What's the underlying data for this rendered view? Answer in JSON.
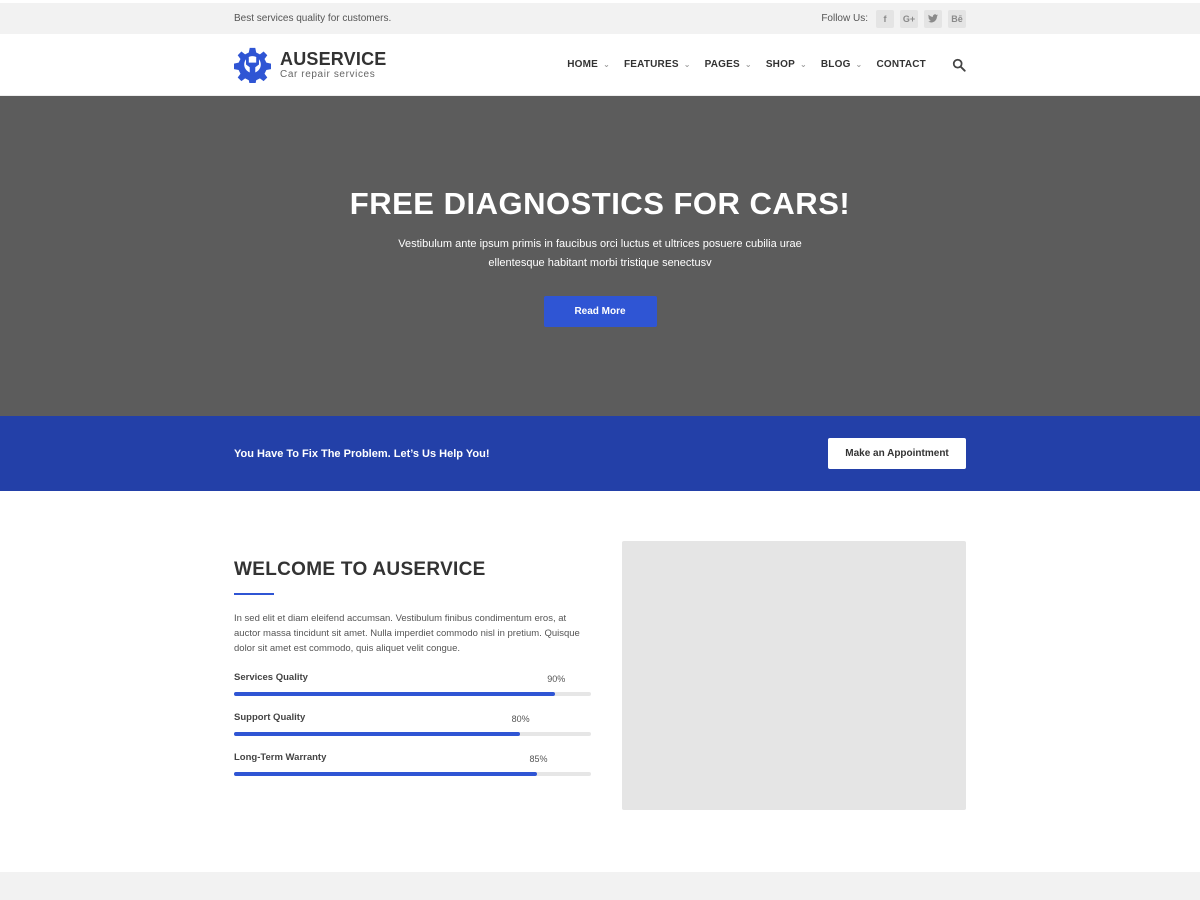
{
  "topbar": {
    "tagline": "Best services quality for customers.",
    "follow_label": "Follow Us:",
    "social": [
      {
        "icon": "facebook-icon",
        "glyph": "f"
      },
      {
        "icon": "google-plus-icon",
        "glyph": "G+"
      },
      {
        "icon": "twitter-icon",
        "glyph": "t"
      },
      {
        "icon": "behance-icon",
        "glyph": "Bē"
      }
    ]
  },
  "header": {
    "brand": "AUSERVICE",
    "brand_sub": "Car repair services",
    "logo_icon": "gear-wrench-icon",
    "nav": [
      {
        "label": "HOME",
        "has_dropdown": true
      },
      {
        "label": "FEATURES",
        "has_dropdown": true
      },
      {
        "label": "PAGES",
        "has_dropdown": true
      },
      {
        "label": "SHOP",
        "has_dropdown": true
      },
      {
        "label": "BLOG",
        "has_dropdown": true
      },
      {
        "label": "CONTACT",
        "has_dropdown": false
      }
    ],
    "search_icon": "search-icon"
  },
  "hero": {
    "title": "FREE DIAGNOSTICS FOR CARS!",
    "text": "Vestibulum ante ipsum primis in faucibus orci luctus et ultrices posuere cubilia urae ellentesque habitant morbi tristique senectusv",
    "button": "Read More",
    "bg_color": "#5c5c5c"
  },
  "cta": {
    "text": "You Have To Fix The Problem. Let’s Us Help You!",
    "button": "Make an Appointment",
    "bg_color": "#2340a8"
  },
  "welcome": {
    "title": "WELCOME TO AUSERVICE",
    "text": "In sed elit et diam eleifend accumsan. Vestibulum finibus condimentum eros, at auctor massa tincidunt sit amet. Nulla imperdiet commodo nisl in pretium. Quisque dolor sit amet est commodo, quis aliquet velit congue.",
    "skills": [
      {
        "name": "Services Quality",
        "percent": 90,
        "label": "90%"
      },
      {
        "name": "Support Quality",
        "percent": 80,
        "label": "80%"
      },
      {
        "name": "Long-Term Warranty",
        "percent": 85,
        "label": "85%"
      }
    ]
  },
  "colors": {
    "accent": "#2f55d4",
    "cta_bg": "#2340a8"
  }
}
